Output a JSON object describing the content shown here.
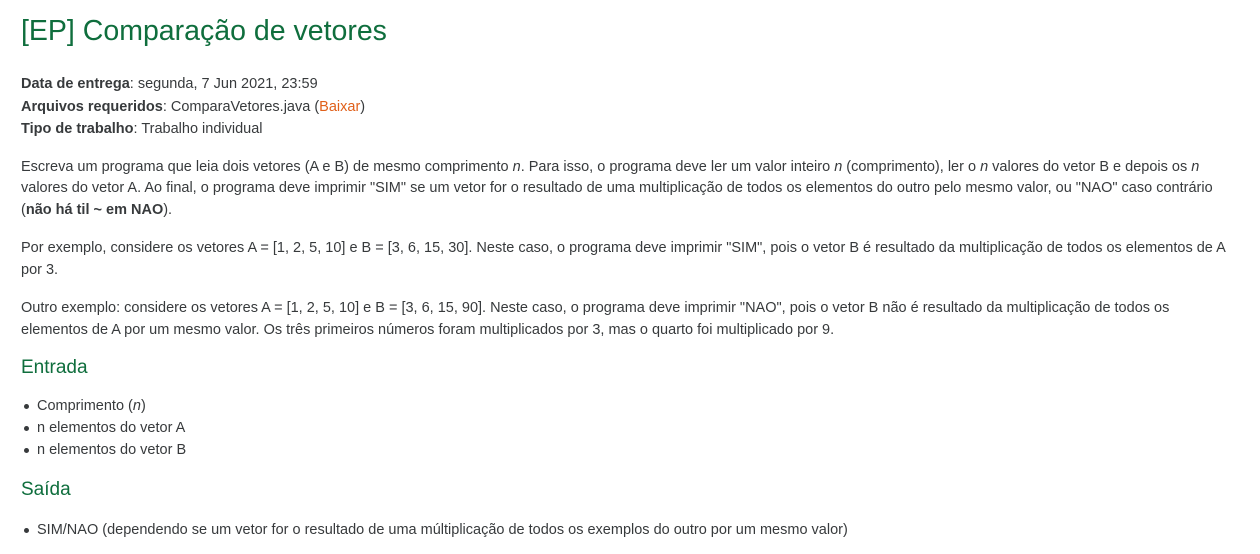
{
  "title": "[EP] Comparação de vetores",
  "meta": {
    "due_label": "Data de entrega",
    "due_value": ": segunda, 7 Jun 2021, 23:59",
    "files_label": "Arquivos requeridos",
    "files_value": ": ComparaVetores.java (",
    "download_link": "Baixar",
    "files_close": ")",
    "type_label": "Tipo de trabalho",
    "type_value": ": Trabalho individual"
  },
  "paragraph1": {
    "a": "Escreva um programa que leia dois vetores (A e B) de mesmo comprimento ",
    "n1": "n",
    "b": ". Para isso, o programa deve ler um valor inteiro ",
    "n2": "n",
    "c": " (comprimento), ler o ",
    "n3": "n",
    "d": " valores do vetor B e depois os ",
    "n4": "n",
    "e": " valores do vetor A. Ao final, o programa deve imprimir \"SIM\" se um vetor for o resultado de uma multiplicação de todos os elementos do outro pelo mesmo valor, ou \"NAO\" caso contrário (",
    "bold": "não há til ~ em NAO",
    "f": ")."
  },
  "paragraph2": "Por exemplo, considere os vetores A = [1, 2, 5, 10] e B = [3, 6, 15, 30]. Neste caso, o programa deve imprimir \"SIM\", pois o vetor B é resultado da multiplicação de todos os elementos de A por 3.",
  "paragraph3": "Outro exemplo: considere os vetores A = [1, 2, 5, 10] e B = [3, 6, 15, 90]. Neste caso, o programa deve imprimir \"NAO\", pois o vetor B não é resultado da multiplicação de todos os elementos de A por um mesmo valor. Os três primeiros números foram multiplicados por 3, mas o quarto foi multiplicado por 9.",
  "entrada": {
    "heading": "Entrada",
    "item1_a": "Comprimento (",
    "item1_n": "n",
    "item1_b": ")",
    "item2": "n elementos do vetor A",
    "item3": "n elementos do vetor B"
  },
  "saida": {
    "heading": "Saída",
    "item1": "SIM/NAO (dependendo se um vetor for o resultado de uma múltiplicação de todos os exemplos do outro por um mesmo valor)"
  },
  "colors": {
    "heading": "#0f6e3d",
    "link": "#e0601a",
    "text": "#373a3c"
  }
}
